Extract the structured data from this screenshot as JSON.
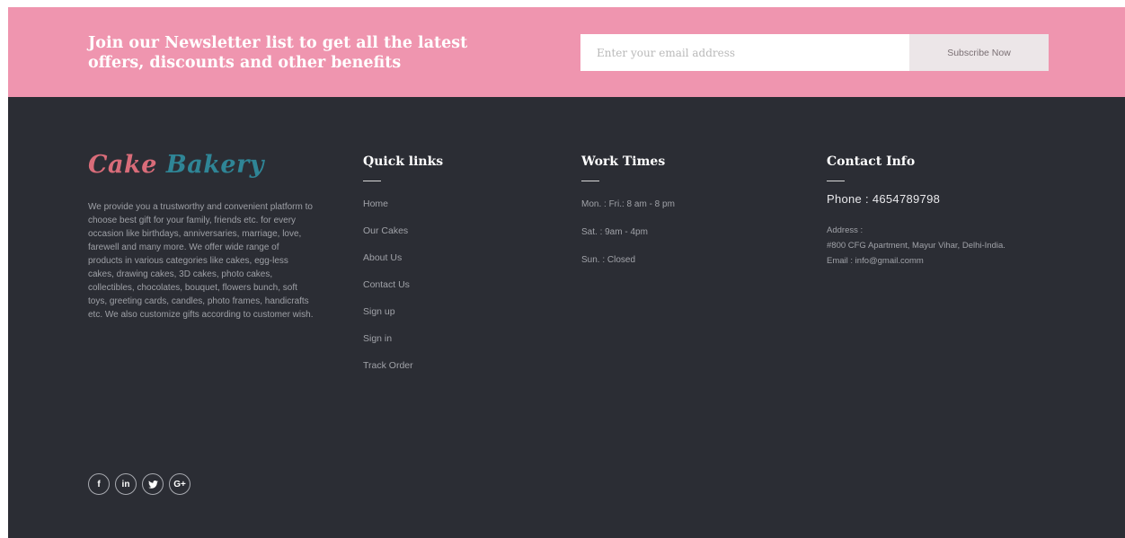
{
  "newsletter": {
    "heading": "Join our Newsletter list to get all the latest offers, discounts and other benefits",
    "email_placeholder": "Enter your email address",
    "subscribe_label": "Subscribe Now"
  },
  "brand": {
    "logo_part1": "Cake",
    "logo_part2": "Bakery",
    "description": "We provide you a trustworthy and convenient platform to choose best gift for your family, friends etc. for every occasion like birthdays, anniversaries, marriage, love, farewell and many more. We offer wide range of products in various categories like cakes, egg-less cakes, drawing cakes, 3D cakes, photo cakes, collectibles, chocolates, bouquet, flowers bunch, soft toys, greeting cards, candles, photo frames, handicrafts etc. We also customize gifts according to customer wish."
  },
  "social": [
    {
      "icon": "facebook-icon",
      "glyph": "f"
    },
    {
      "icon": "linkedin-icon",
      "glyph": "in"
    },
    {
      "icon": "twitter-icon",
      "glyph": "❤"
    },
    {
      "icon": "google-plus-icon",
      "glyph": "G+"
    }
  ],
  "quick_links": {
    "title": "Quick links",
    "items": [
      "Home",
      "Our Cakes",
      "About Us",
      "Contact Us",
      "Sign up",
      "Sign in",
      "Track Order"
    ]
  },
  "work_times": {
    "title": "Work Times",
    "items": [
      "Mon. : Fri.: 8 am - 8 pm",
      "Sat. : 9am - 4pm",
      "Sun. : Closed"
    ]
  },
  "contact": {
    "title": "Contact Info",
    "phone": "Phone : 4654789798",
    "address_label": "Address :",
    "address": "#800 CFG Apartment, Mayur Vihar, Delhi-India.",
    "email": "Email : info@gmail.comm"
  },
  "colors": {
    "newsletter_bg": "#ef95af",
    "footer_bg": "#2b2d34",
    "logo_accent_1": "#d96c79",
    "logo_accent_2": "#2f8596"
  }
}
